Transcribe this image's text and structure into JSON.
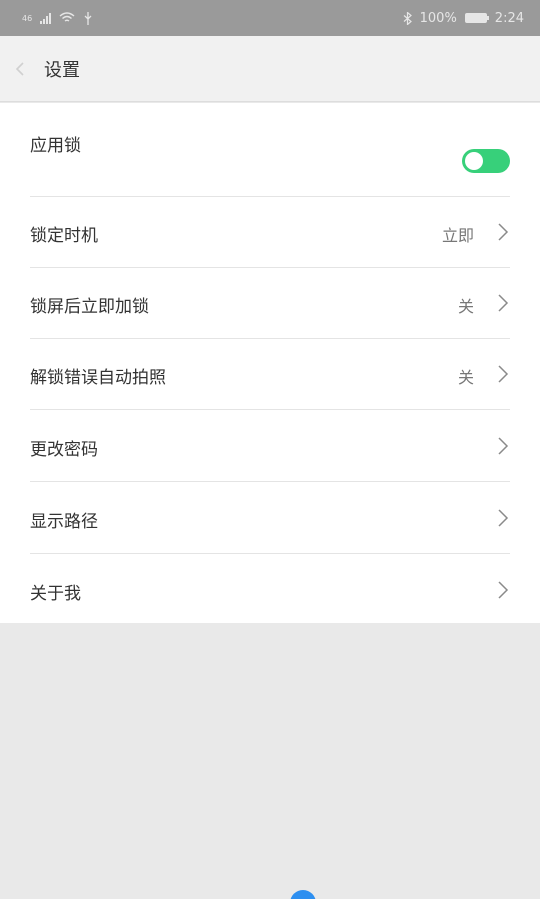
{
  "status_bar": {
    "network": "46",
    "battery": "100%",
    "battery_level": 1.0,
    "time": "2:24",
    "icons": [
      "signal-icon",
      "wifi-icon",
      "usb-icon",
      "bluetooth-icon",
      "battery-icon"
    ]
  },
  "header": {
    "title": "设置",
    "back_icon": "chevron-left-icon"
  },
  "settings": {
    "app_lock": {
      "label": "应用锁",
      "enabled": true
    },
    "lock_timing": {
      "label": "锁定时机",
      "value": "立即"
    },
    "lock_after_screen": {
      "label": "锁屏后立即加锁",
      "value": "关"
    },
    "unlock_error_photo": {
      "label": "解锁错误自动拍照",
      "value": "关"
    },
    "change_password": {
      "label": "更改密码"
    },
    "show_path": {
      "label": "显示路径"
    },
    "about_me": {
      "label": "关于我"
    }
  },
  "colors": {
    "toggle_on": "#37d07a",
    "status_bar": "#9a9a9a",
    "title_bar": "#f1f1f1",
    "accent": "#2d8ff0"
  }
}
